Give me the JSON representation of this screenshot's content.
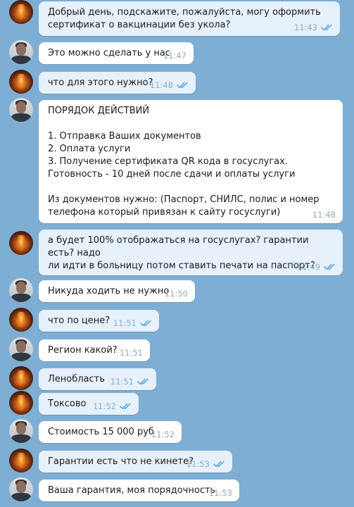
{
  "messages": [
    {
      "sender": "user",
      "text": "Добрый день, подскажите, пожалуйста, могу оформить\nсертификат о вакцинации без укола?",
      "time": "11:43",
      "read": true
    },
    {
      "sender": "agent",
      "text": "Это можно сделать у нас",
      "time": "11:47",
      "read": false
    },
    {
      "sender": "user",
      "text": "что для этого нужно?",
      "time": "11:48",
      "read": true
    },
    {
      "sender": "agent",
      "text": "ПОРЯДОК ДЕЙСТВИЙ\n\n1. Отправка Ваших документов\n2. Оплата услуги\n3. Получение сертификата QR кода в госуслугах.\nГотовность - 10 дней после сдачи и оплаты услуги\n\nИз документов нужно: (Паспорт, СНИЛС, полис и номер\nтелефона который привязан к сайту госуслуги)",
      "time": "11:48",
      "read": false
    },
    {
      "sender": "user",
      "text": "а будет 100% отображаться на госуслугах? гарантии есть? надо\nли идти в больницу потом ставить печати на паспорт?",
      "time": "11:49",
      "read": true
    },
    {
      "sender": "agent",
      "text": "Никуда ходить не нужно",
      "time": "11:50",
      "read": false
    },
    {
      "sender": "user",
      "text": "что по цене?",
      "time": "11:51",
      "read": true
    },
    {
      "sender": "agent",
      "text": "Регион какой?",
      "time": "11:51",
      "read": false
    },
    {
      "sender": "user",
      "text": "Ленобласть",
      "time": "11:51",
      "read": true
    },
    {
      "sender": "user",
      "text": "Токсово",
      "time": "11:52",
      "read": true
    },
    {
      "sender": "agent",
      "text": "Стоимость 15 000 руб",
      "time": "11:52",
      "read": false
    },
    {
      "sender": "user",
      "text": "Гарантии есть что не кинете?",
      "time": "11:53",
      "read": true
    },
    {
      "sender": "agent",
      "text": "Ваша гарантия, моя порядочность",
      "time": "11:53",
      "read": false
    }
  ],
  "colors": {
    "background": "#7eaed3",
    "incoming_bubble": "#ffffff",
    "outgoing_bubble": "#e6f1fb",
    "read_check": "#4fa3e0"
  }
}
